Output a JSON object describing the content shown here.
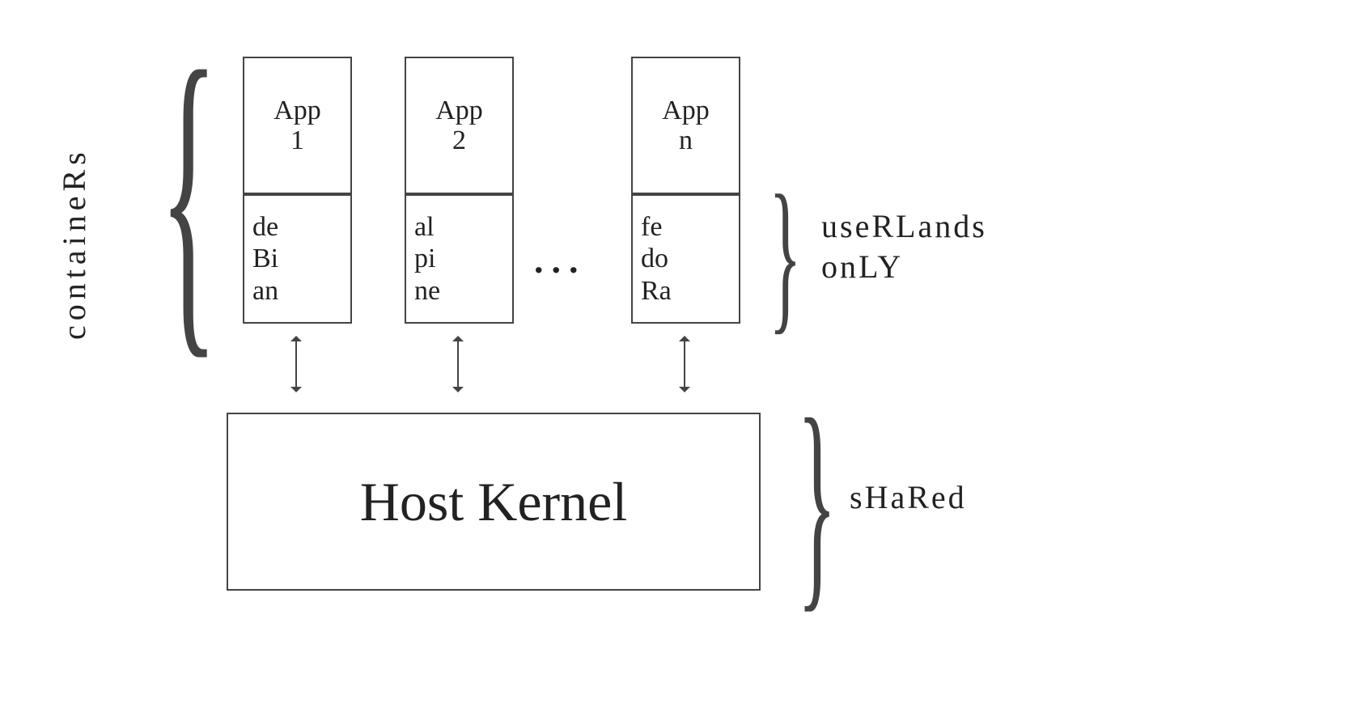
{
  "labels": {
    "containers": "containeRs",
    "userlands": "useRLands\nonLY",
    "shared": "sHaRed",
    "ellipsis": "..."
  },
  "containers": [
    {
      "app": "App\n1",
      "os": "de\nBi\nan"
    },
    {
      "app": "App\n2",
      "os": "al\npi\nne"
    },
    {
      "app": "App\nn",
      "os": "fe\ndo\nRa"
    }
  ],
  "kernel": "Host Kernel"
}
